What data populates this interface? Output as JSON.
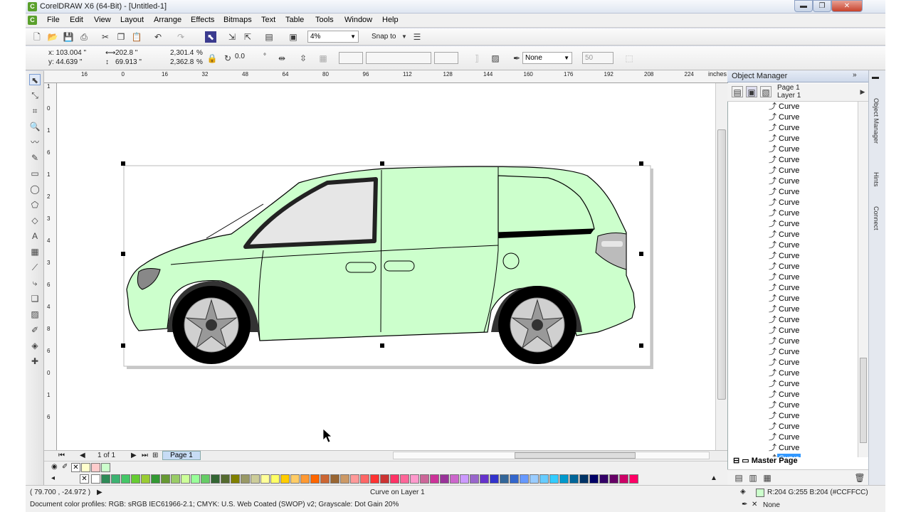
{
  "window": {
    "title": "CorelDRAW X6 (64-Bit) - [Untitled-1]",
    "min": "▬",
    "restore": "❐",
    "close": "✕"
  },
  "menu": [
    "File",
    "Edit",
    "View",
    "Layout",
    "Arrange",
    "Effects",
    "Bitmaps",
    "Text",
    "Table",
    "Tools",
    "Window",
    "Help"
  ],
  "toolbar1": {
    "zoom": "4%",
    "snap_to": "Snap to"
  },
  "property_bar": {
    "x": "x:  103.004 \"",
    "y": "y:  44.639 \"",
    "width": "202.8 \"",
    "height": "69.913 \"",
    "scale_x": "2,301.4",
    "scale_y": "2,362.8",
    "pct_x": "%",
    "pct_y": "%",
    "angle": "0.0",
    "angle_unit": "°",
    "outline": "None",
    "number": "50"
  },
  "ruler": {
    "h_ticks": [
      "16",
      "0",
      "16",
      "32",
      "48",
      "64",
      "80",
      "96",
      "112",
      "128",
      "144",
      "160",
      "176",
      "192",
      "208",
      "224"
    ],
    "units": "inches",
    "v_ticks": [
      "1",
      "0",
      "1",
      "6",
      "1",
      "2",
      "3",
      "4",
      "3",
      "6",
      "4",
      "8",
      "6",
      "0",
      "1",
      "6"
    ]
  },
  "page_nav": {
    "count": "1 of 1",
    "page_tab": "Page 1"
  },
  "status": {
    "coords": "( 79.700 , -24.972 )",
    "selection": "Curve on Layer 1",
    "color_profiles": "Document color profiles: RGB: sRGB IEC61966-2.1; CMYK: U.S. Web Coated (SWOP) v2; Grayscale: Dot Gain 20%",
    "fill": "R:204 G:255 B:204 (#CCFFCC)",
    "outline": "None"
  },
  "object_manager": {
    "title": "Object Manager",
    "page": "Page 1",
    "layer": "Layer 1",
    "items": [
      "Curve",
      "Curve",
      "Curve",
      "Curve",
      "Curve",
      "Curve",
      "Curve",
      "Curve",
      "Curve",
      "Curve",
      "Curve",
      "Curve",
      "Curve",
      "Curve",
      "Curve",
      "Curve",
      "Curve",
      "Curve",
      "Curve",
      "Curve",
      "Curve",
      "Curve",
      "Curve",
      "Curve",
      "Curve",
      "Curve",
      "Curve",
      "Curve",
      "Curve",
      "Curve",
      "Curve",
      "Curve",
      "Curve",
      "Curve"
    ],
    "master": "Master Page"
  },
  "side_tabs": [
    "Object Manager",
    "Hints",
    "Connect"
  ],
  "colors": {
    "accent": "#3399ff",
    "fill": "#CCFFCC",
    "page_tab": "#c7dcf5"
  },
  "palette": [
    "#ffffff",
    "#2e8b57",
    "#3cb371",
    "#44c767",
    "#66cc33",
    "#99cc33",
    "#339933",
    "#669933",
    "#99cc66",
    "#ccff99",
    "#99ff99",
    "#66cc66",
    "#336633",
    "#556b2f",
    "#808000",
    "#999966",
    "#cccc99",
    "#ffff99",
    "#ffff66",
    "#ffcc00",
    "#ffcc66",
    "#ff9933",
    "#ff6600",
    "#cc6633",
    "#996633",
    "#cc9966",
    "#ff9999",
    "#ff6666",
    "#ff3333",
    "#cc3333",
    "#ff3366",
    "#ff6699",
    "#ff99cc",
    "#cc6699",
    "#cc3399",
    "#993399",
    "#cc66cc",
    "#cc99ff",
    "#9966cc",
    "#6633cc",
    "#3333cc",
    "#336699",
    "#3366cc",
    "#6699ff",
    "#99ccff",
    "#66ccff",
    "#33ccff",
    "#0099cc",
    "#006699",
    "#003366",
    "#000066",
    "#330066",
    "#660066",
    "#cc0066",
    "#ff0066"
  ],
  "recent_colors": [
    "#ffffcc",
    "#ffcccc",
    "#ccffcc"
  ]
}
